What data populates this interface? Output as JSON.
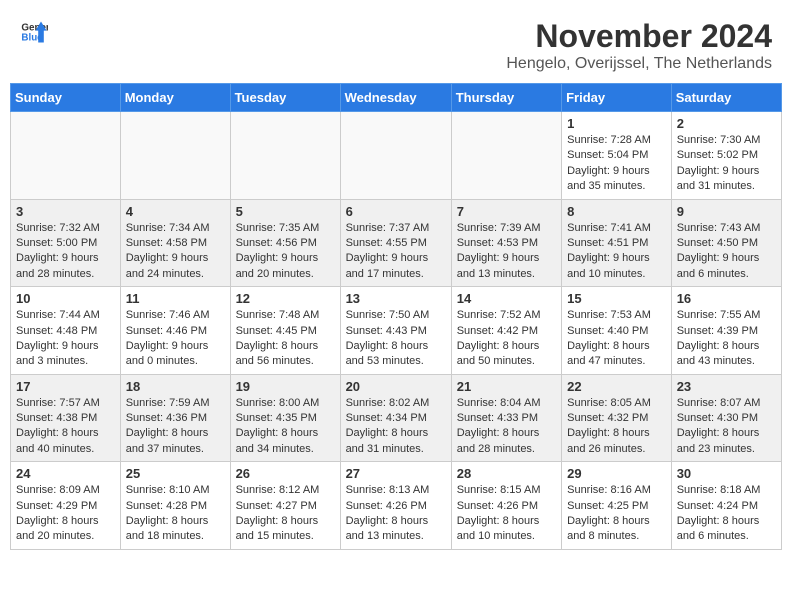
{
  "logo": {
    "general": "General",
    "blue": "Blue"
  },
  "title": "November 2024",
  "subtitle": "Hengelo, Overijssel, The Netherlands",
  "days_header": [
    "Sunday",
    "Monday",
    "Tuesday",
    "Wednesday",
    "Thursday",
    "Friday",
    "Saturday"
  ],
  "weeks": [
    [
      {
        "day": "",
        "info": ""
      },
      {
        "day": "",
        "info": ""
      },
      {
        "day": "",
        "info": ""
      },
      {
        "day": "",
        "info": ""
      },
      {
        "day": "",
        "info": ""
      },
      {
        "day": "1",
        "info": "Sunrise: 7:28 AM\nSunset: 5:04 PM\nDaylight: 9 hours and 35 minutes."
      },
      {
        "day": "2",
        "info": "Sunrise: 7:30 AM\nSunset: 5:02 PM\nDaylight: 9 hours and 31 minutes."
      }
    ],
    [
      {
        "day": "3",
        "info": "Sunrise: 7:32 AM\nSunset: 5:00 PM\nDaylight: 9 hours and 28 minutes."
      },
      {
        "day": "4",
        "info": "Sunrise: 7:34 AM\nSunset: 4:58 PM\nDaylight: 9 hours and 24 minutes."
      },
      {
        "day": "5",
        "info": "Sunrise: 7:35 AM\nSunset: 4:56 PM\nDaylight: 9 hours and 20 minutes."
      },
      {
        "day": "6",
        "info": "Sunrise: 7:37 AM\nSunset: 4:55 PM\nDaylight: 9 hours and 17 minutes."
      },
      {
        "day": "7",
        "info": "Sunrise: 7:39 AM\nSunset: 4:53 PM\nDaylight: 9 hours and 13 minutes."
      },
      {
        "day": "8",
        "info": "Sunrise: 7:41 AM\nSunset: 4:51 PM\nDaylight: 9 hours and 10 minutes."
      },
      {
        "day": "9",
        "info": "Sunrise: 7:43 AM\nSunset: 4:50 PM\nDaylight: 9 hours and 6 minutes."
      }
    ],
    [
      {
        "day": "10",
        "info": "Sunrise: 7:44 AM\nSunset: 4:48 PM\nDaylight: 9 hours and 3 minutes."
      },
      {
        "day": "11",
        "info": "Sunrise: 7:46 AM\nSunset: 4:46 PM\nDaylight: 9 hours and 0 minutes."
      },
      {
        "day": "12",
        "info": "Sunrise: 7:48 AM\nSunset: 4:45 PM\nDaylight: 8 hours and 56 minutes."
      },
      {
        "day": "13",
        "info": "Sunrise: 7:50 AM\nSunset: 4:43 PM\nDaylight: 8 hours and 53 minutes."
      },
      {
        "day": "14",
        "info": "Sunrise: 7:52 AM\nSunset: 4:42 PM\nDaylight: 8 hours and 50 minutes."
      },
      {
        "day": "15",
        "info": "Sunrise: 7:53 AM\nSunset: 4:40 PM\nDaylight: 8 hours and 47 minutes."
      },
      {
        "day": "16",
        "info": "Sunrise: 7:55 AM\nSunset: 4:39 PM\nDaylight: 8 hours and 43 minutes."
      }
    ],
    [
      {
        "day": "17",
        "info": "Sunrise: 7:57 AM\nSunset: 4:38 PM\nDaylight: 8 hours and 40 minutes."
      },
      {
        "day": "18",
        "info": "Sunrise: 7:59 AM\nSunset: 4:36 PM\nDaylight: 8 hours and 37 minutes."
      },
      {
        "day": "19",
        "info": "Sunrise: 8:00 AM\nSunset: 4:35 PM\nDaylight: 8 hours and 34 minutes."
      },
      {
        "day": "20",
        "info": "Sunrise: 8:02 AM\nSunset: 4:34 PM\nDaylight: 8 hours and 31 minutes."
      },
      {
        "day": "21",
        "info": "Sunrise: 8:04 AM\nSunset: 4:33 PM\nDaylight: 8 hours and 28 minutes."
      },
      {
        "day": "22",
        "info": "Sunrise: 8:05 AM\nSunset: 4:32 PM\nDaylight: 8 hours and 26 minutes."
      },
      {
        "day": "23",
        "info": "Sunrise: 8:07 AM\nSunset: 4:30 PM\nDaylight: 8 hours and 23 minutes."
      }
    ],
    [
      {
        "day": "24",
        "info": "Sunrise: 8:09 AM\nSunset: 4:29 PM\nDaylight: 8 hours and 20 minutes."
      },
      {
        "day": "25",
        "info": "Sunrise: 8:10 AM\nSunset: 4:28 PM\nDaylight: 8 hours and 18 minutes."
      },
      {
        "day": "26",
        "info": "Sunrise: 8:12 AM\nSunset: 4:27 PM\nDaylight: 8 hours and 15 minutes."
      },
      {
        "day": "27",
        "info": "Sunrise: 8:13 AM\nSunset: 4:26 PM\nDaylight: 8 hours and 13 minutes."
      },
      {
        "day": "28",
        "info": "Sunrise: 8:15 AM\nSunset: 4:26 PM\nDaylight: 8 hours and 10 minutes."
      },
      {
        "day": "29",
        "info": "Sunrise: 8:16 AM\nSunset: 4:25 PM\nDaylight: 8 hours and 8 minutes."
      },
      {
        "day": "30",
        "info": "Sunrise: 8:18 AM\nSunset: 4:24 PM\nDaylight: 8 hours and 6 minutes."
      }
    ]
  ]
}
